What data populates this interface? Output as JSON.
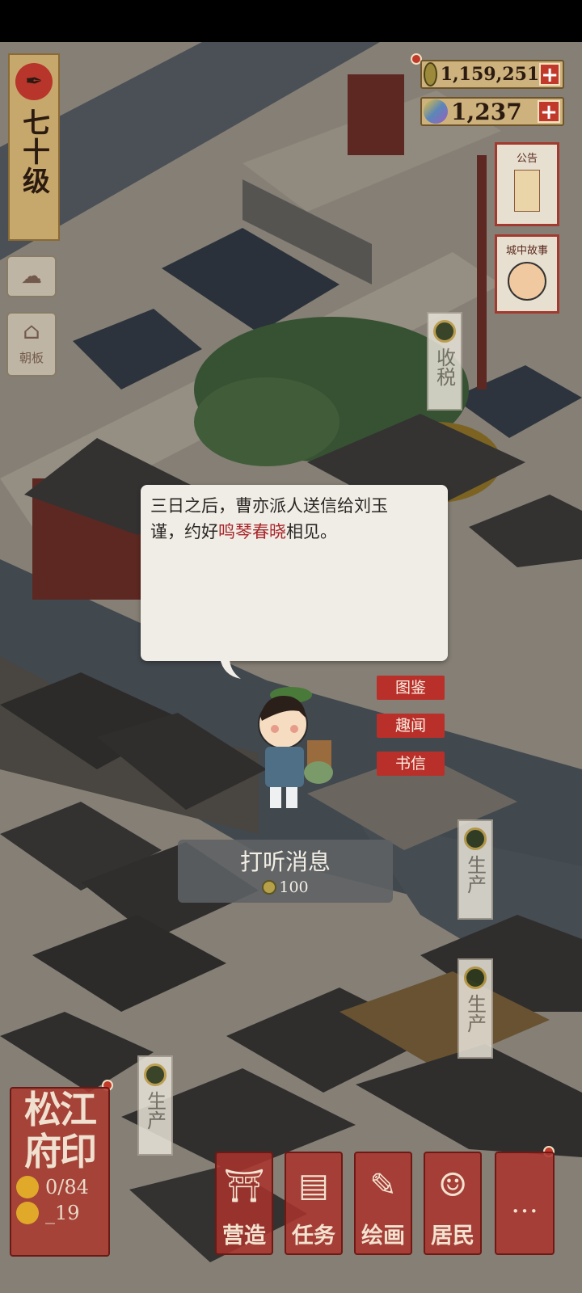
{
  "hud": {
    "level": "七十级",
    "coins": "1,159,251",
    "gems": "1,237",
    "plus": "+"
  },
  "right_notices": {
    "announcement": "公告",
    "city_story": "城中故事"
  },
  "left_buttons": {
    "court": "朝板"
  },
  "dialog": {
    "line1": "三日之后，曹亦派人送信给刘玉",
    "line2_pre": "谨，约好",
    "line2_highlight": "鸣琴春晓",
    "line2_post": "相见。"
  },
  "side_tags": [
    "图鉴",
    "趣闻",
    "书信"
  ],
  "inquire": {
    "title": "打听消息",
    "cost": "100"
  },
  "signs": {
    "tax": "收税",
    "produce": "生产"
  },
  "city_seal": {
    "line1": "松江",
    "line2": "府印",
    "population": "0/84",
    "second_value": "_19"
  },
  "bottom_nav": [
    {
      "label": "营造",
      "icon": "pavilion-icon"
    },
    {
      "label": "任务",
      "icon": "book-icon"
    },
    {
      "label": "绘画",
      "icon": "scroll-icon"
    },
    {
      "label": "居民",
      "icon": "person-icon"
    },
    {
      "label": "…",
      "icon": "more-icon"
    }
  ],
  "colors": {
    "accent_red": "#b9302b",
    "parchment": "#cdb27d",
    "dialog_bg": "#f0ede6",
    "highlight": "#a8272c"
  }
}
